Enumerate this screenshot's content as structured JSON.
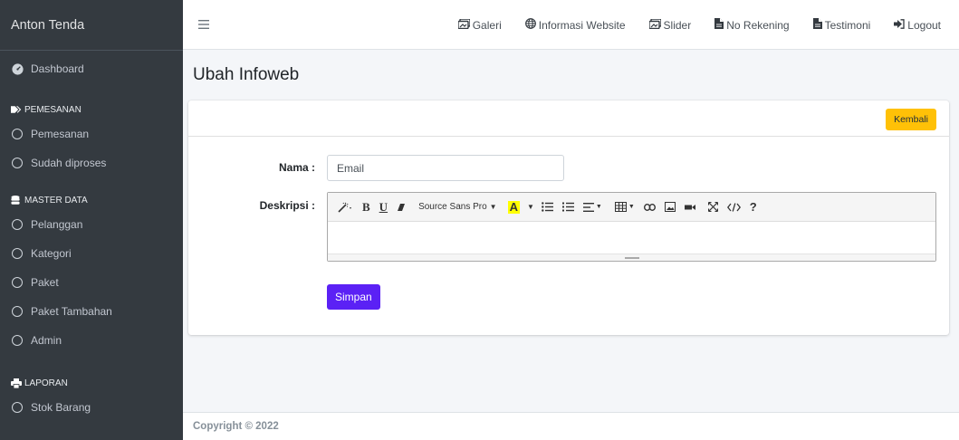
{
  "sidebar": {
    "brand": "Anton Tenda",
    "dashboard": "Dashboard",
    "sections": [
      {
        "header": "PEMESANAN",
        "items": [
          "Pemesanan",
          "Sudah diproses"
        ]
      },
      {
        "header": "MASTER DATA",
        "items": [
          "Pelanggan",
          "Kategori",
          "Paket",
          "Paket Tambahan",
          "Admin"
        ]
      },
      {
        "header": "LAPORAN",
        "items": [
          "Stok Barang"
        ]
      }
    ]
  },
  "navbar": {
    "links": [
      "Galeri",
      "Informasi Website",
      "Slider",
      "No Rekening",
      "Testimoni",
      "Logout"
    ]
  },
  "page": {
    "title": "Ubah Infoweb",
    "back_label": "Kembali",
    "nama_label": "Nama :",
    "nama_value": "Email",
    "deskripsi_label": "Deskripsi :",
    "font_name": "Source Sans Pro",
    "save_label": "Simpan"
  },
  "footer": {
    "copyright": "Copyright © 2022"
  },
  "colors": {
    "sidebar": "#343a40",
    "accent": "#5b21f5",
    "warning": "#ffc107"
  }
}
